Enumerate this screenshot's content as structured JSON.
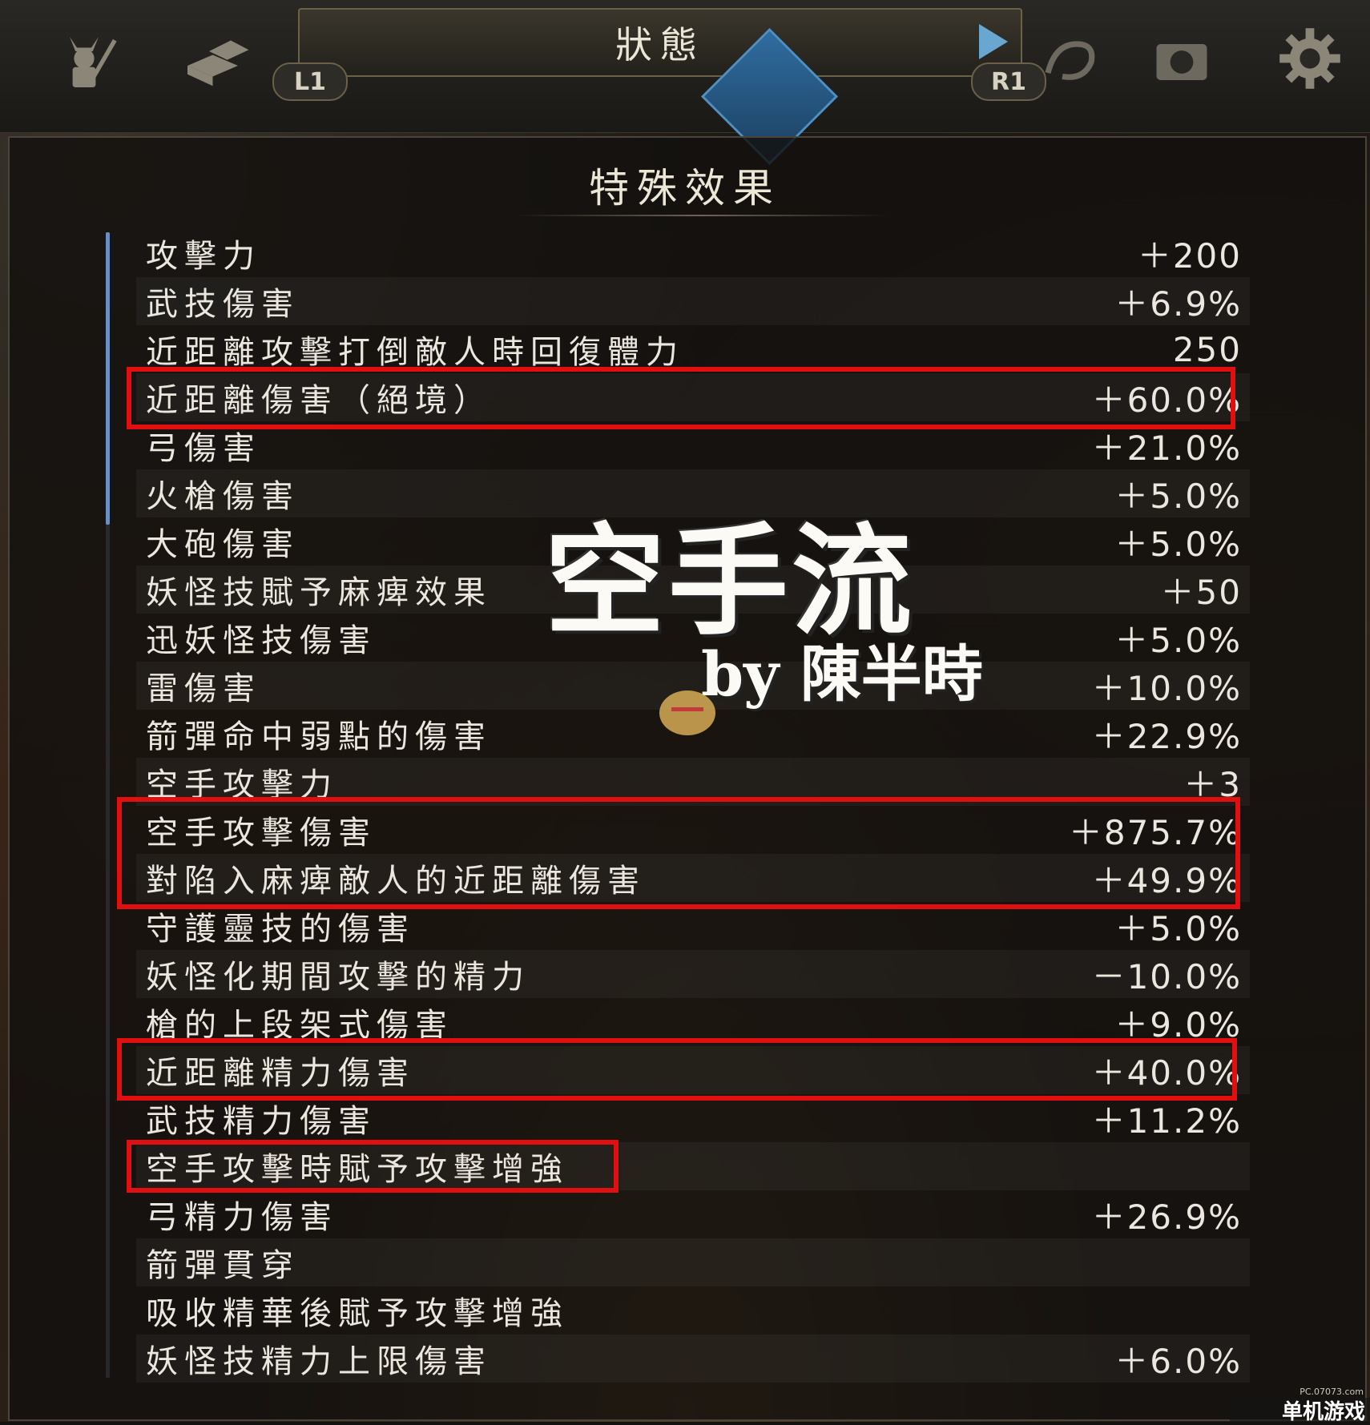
{
  "header": {
    "title": "狀態",
    "left_button": "L1",
    "right_button": "R1",
    "icons": [
      "samurai-helmet-icon",
      "inventory-boxes-icon",
      "spirit-diamond-icon",
      "dragon-icon",
      "camera-icon",
      "gear-icon"
    ]
  },
  "panel": {
    "title": "特殊效果",
    "rows": [
      {
        "label": "攻擊力",
        "value": "＋200"
      },
      {
        "label": "武技傷害",
        "value": "＋6.9%"
      },
      {
        "label": "近距離攻擊打倒敵人時回復體力",
        "value": "250"
      },
      {
        "label": "近距離傷害（絕境）",
        "value": "＋60.0%"
      },
      {
        "label": "弓傷害",
        "value": "＋21.0%"
      },
      {
        "label": "火槍傷害",
        "value": "＋5.0%"
      },
      {
        "label": "大砲傷害",
        "value": "＋5.0%"
      },
      {
        "label": "妖怪技賦予麻痺效果",
        "value": "＋50"
      },
      {
        "label": "迅妖怪技傷害",
        "value": "＋5.0%"
      },
      {
        "label": "雷傷害",
        "value": "＋10.0%"
      },
      {
        "label": "箭彈命中弱點的傷害",
        "value": "＋22.9%"
      },
      {
        "label": "空手攻擊力",
        "value": "＋3"
      },
      {
        "label": "空手攻擊傷害",
        "value": "＋875.7%"
      },
      {
        "label": "對陷入麻痺敵人的近距離傷害",
        "value": "＋49.9%"
      },
      {
        "label": "守護靈技的傷害",
        "value": "＋5.0%"
      },
      {
        "label": "妖怪化期間攻擊的精力",
        "value": "－10.0%"
      },
      {
        "label": "槍的上段架式傷害",
        "value": "＋9.0%"
      },
      {
        "label": "近距離精力傷害",
        "value": "＋40.0%"
      },
      {
        "label": "武技精力傷害",
        "value": "＋11.2%"
      },
      {
        "label": "空手攻擊時賦予攻擊增強",
        "value": ""
      },
      {
        "label": "弓精力傷害",
        "value": "＋26.9%"
      },
      {
        "label": "箭彈貫穿",
        "value": ""
      },
      {
        "label": "吸收精華後賦予攻擊增強",
        "value": ""
      },
      {
        "label": "妖怪技精力上限傷害",
        "value": "＋6.0%"
      }
    ]
  },
  "overlay": {
    "title": "空手流",
    "byline": "by 陳半時"
  },
  "watermark": {
    "text": "单机游戏",
    "site": "PC.07073.com"
  },
  "colors": {
    "highlight": "#e10f0f",
    "accent_blue": "#6aa7d0"
  }
}
